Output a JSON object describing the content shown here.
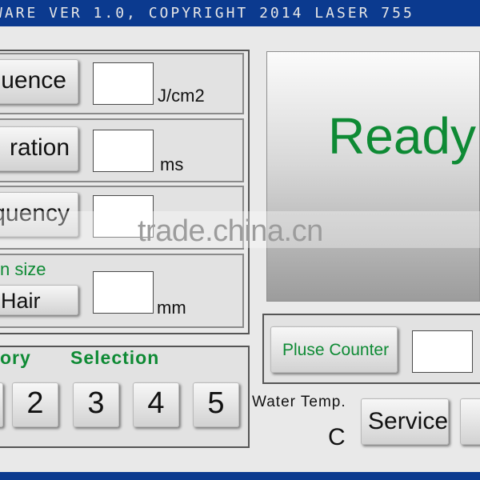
{
  "window": {
    "title": "WARE VER 1.0, COPYRIGHT 2014 LASER 755"
  },
  "parameters": {
    "fluence": {
      "label": "uence",
      "value": "",
      "unit": "J/cm2"
    },
    "duration": {
      "label": "ration",
      "value": "",
      "unit": "ms"
    },
    "frequency": {
      "label": "equency",
      "value": "",
      "unit": ""
    },
    "spot_size": {
      "heading": "n size",
      "label": "Hair",
      "value": "",
      "unit": "mm"
    }
  },
  "memory": {
    "label": "ory",
    "selection_label": "Selection",
    "buttons": [
      "2",
      "3",
      "4",
      "5"
    ]
  },
  "display": {
    "status": "Ready"
  },
  "counter": {
    "label": "Pluse Counter",
    "value": ""
  },
  "water": {
    "label": "Water Temp.",
    "unit": "C"
  },
  "service": {
    "label": "Service"
  },
  "watermark": {
    "text": "trade.china.cn"
  },
  "colors": {
    "title_bar": "#0b3a8f",
    "status_text": "#0e8a34",
    "label_green": "#0e8a34"
  }
}
